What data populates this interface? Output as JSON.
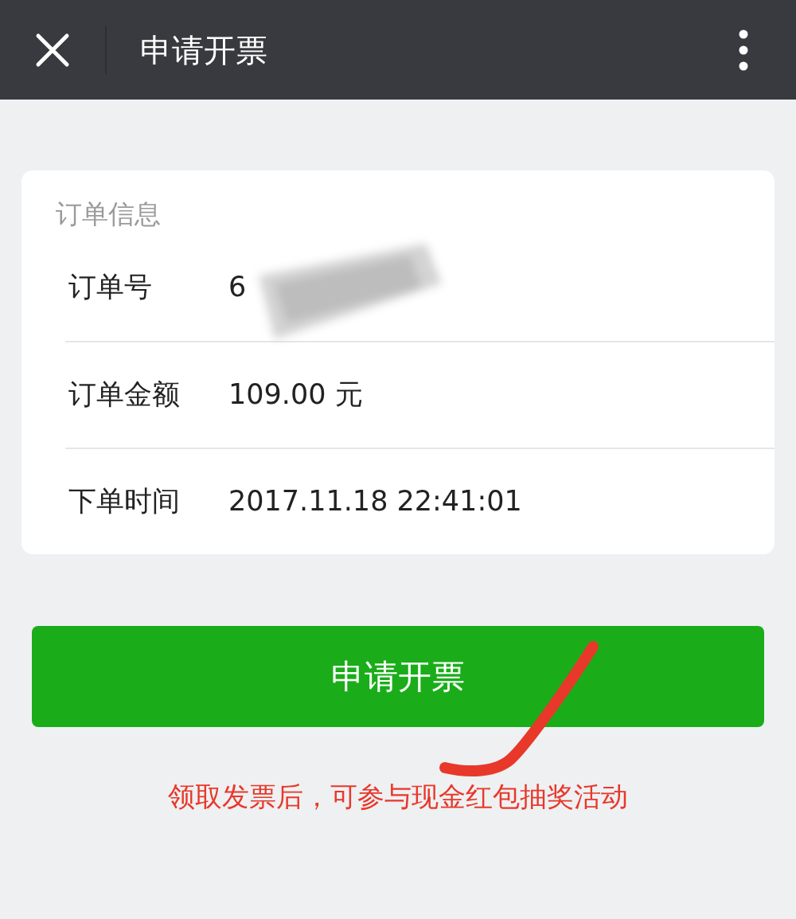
{
  "header": {
    "title": "申请开票"
  },
  "card": {
    "section_title": "订单信息",
    "rows": [
      {
        "label": "订单号",
        "value": "6",
        "redacted": true
      },
      {
        "label": "订单金额",
        "value": "109.00 元",
        "redacted": false
      },
      {
        "label": "下单时间",
        "value": "2017.11.18 22:41:01",
        "redacted": false
      }
    ]
  },
  "button": {
    "label": "申请开票"
  },
  "annotation": {
    "note": "领取发票后，可参与现金红包抽奖活动"
  }
}
